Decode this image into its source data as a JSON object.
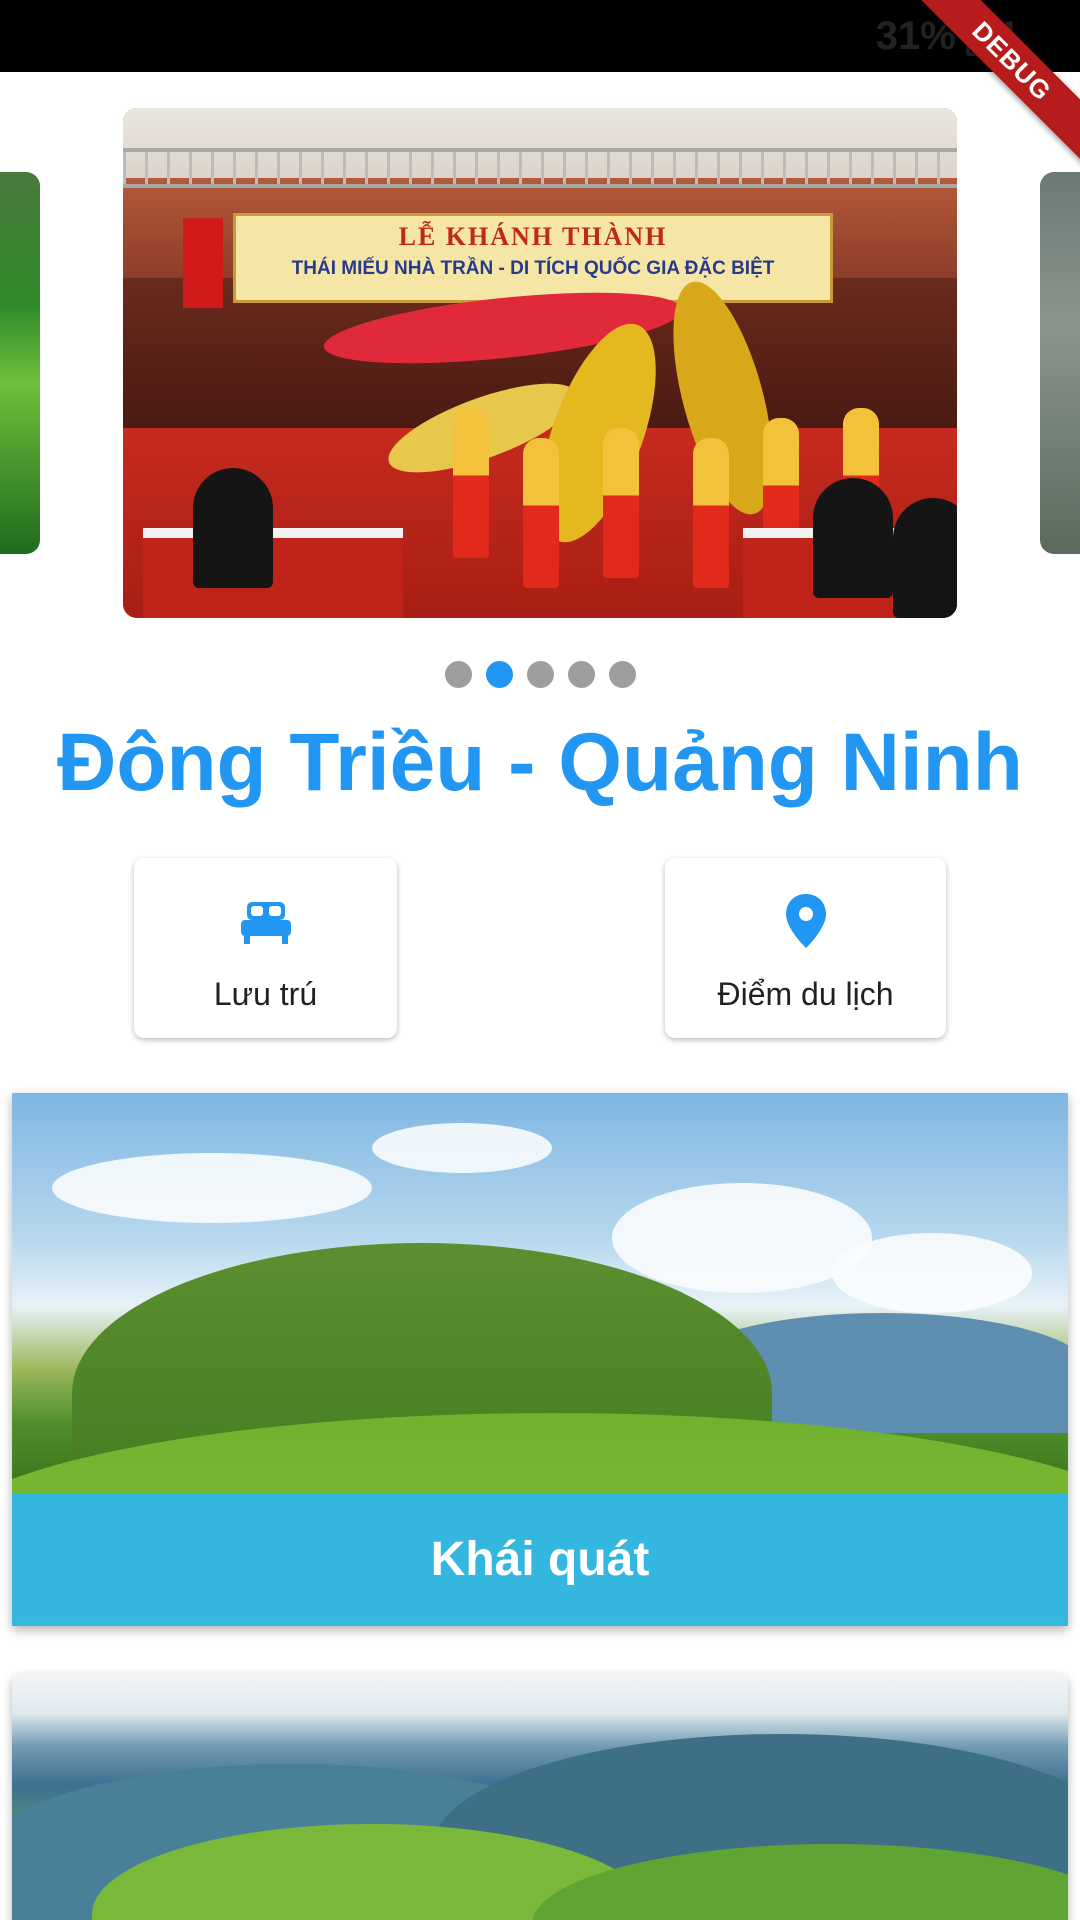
{
  "status_bar": {
    "battery_text": "31%",
    "time_partial": "1"
  },
  "debug_banner": "DEBUG",
  "carousel": {
    "banner_line1": "LỄ KHÁNH THÀNH",
    "banner_line2": "THÁI MIẾU NHÀ TRẦN - DI TÍCH QUỐC GIA ĐẶC BIỆT",
    "slide_count": 5,
    "active_index": 1
  },
  "title": "Đông Triều - Quảng Ninh",
  "actions": [
    {
      "label": "Lưu trú",
      "icon": "bed-icon"
    },
    {
      "label": "Điểm du lịch",
      "icon": "location-pin-icon"
    }
  ],
  "features": [
    {
      "label": "Khái quát"
    }
  ],
  "colors": {
    "accent": "#2196f3",
    "caption_overlay": "#29b6f6"
  }
}
